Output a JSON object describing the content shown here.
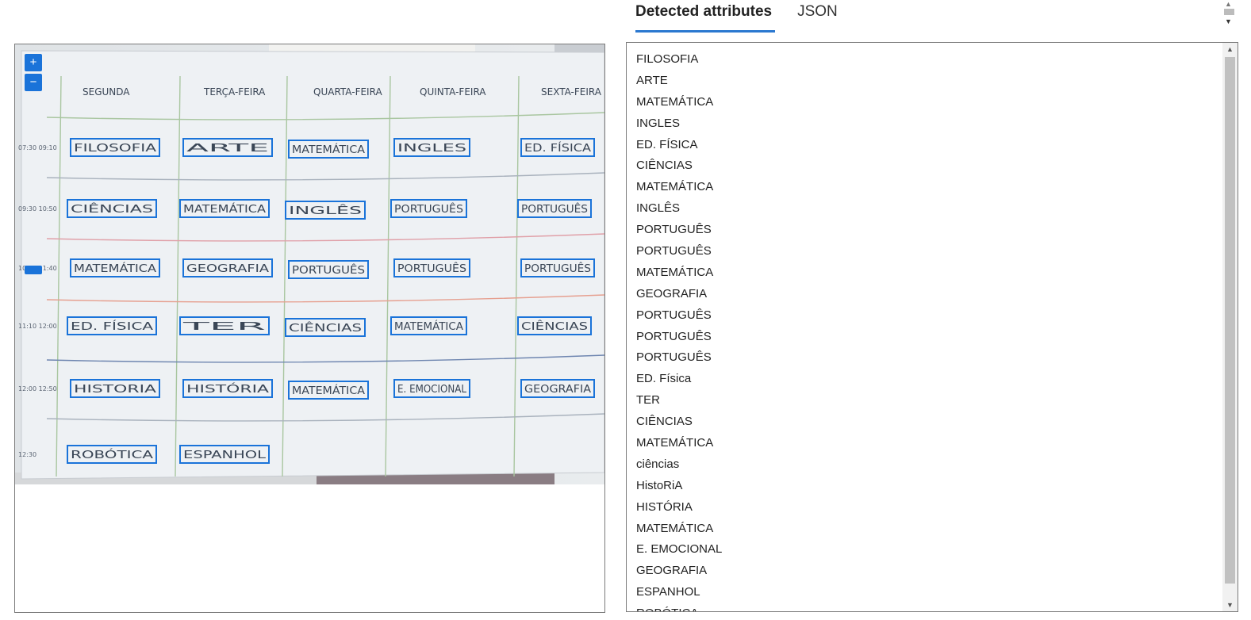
{
  "tabs": [
    {
      "label": "Detected attributes",
      "active": true
    },
    {
      "label": "JSON",
      "active": false
    }
  ],
  "viewer": {
    "zoom_in_label": "+",
    "zoom_out_label": "−",
    "board": {
      "days": [
        "SEGUNDA",
        "TERÇA-FEIRA",
        "QUARTA-FEIRA",
        "QUINTA-FEIRA",
        "SEXTA-FEIRA"
      ],
      "times": [
        "07:30 09:10",
        "09:30 10:50",
        "10:50 11:40",
        "11:10 12:00",
        "12:00 12:50",
        "12:30"
      ],
      "rows": [
        [
          "FILOSOFIA",
          "ARTE",
          "MATEMÁTICA",
          "INGLES",
          "ED. FÍSICA"
        ],
        [
          "CIÊNCIAS",
          "MATEMÁTICA",
          "INGLÊS",
          "PORTUGUÊS",
          "PORTUGUÊS"
        ],
        [
          "MATEMÁTICA",
          "GEOGRAFIA",
          "PORTUGUÊS",
          "PORTUGUÊS",
          "PORTUGUÊS"
        ],
        [
          "ED. FÍSICA",
          "TER",
          "CIÊNCIAS",
          "MATEMÁTICA",
          "CIÊNCIAS"
        ],
        [
          "HISTORIA",
          "HISTÓRIA",
          "MATEMÁTICA",
          "E. EMOCIONAL",
          "GEOGRAFIA"
        ],
        [
          "ROBÓTICA",
          "ESPANHOL",
          "",
          "",
          ""
        ]
      ]
    }
  },
  "attributes": [
    "FILOSOFIA",
    "ARTE",
    "MATEMÁTICA",
    "INGLES",
    "ED. FÍSICA",
    "CIÊNCIAS",
    "MATEMÁTICA",
    "INGLÊS",
    "PORTUGUÊS",
    "PORTUGUÊS",
    "MATEMÁTICA",
    "GEOGRAFIA",
    "PORTUGUÊS",
    "PORTUGUÊS",
    "PORTUGUÊS",
    "ED. Física",
    "TER",
    "CIÊNCIAS",
    "MATEMÁTICA",
    "ciências",
    "HistoRiA",
    "HISTÓRIA",
    "MATEMÁTICA",
    "E. EMOCIONAL",
    "GEOGRAFIA",
    "ESPANHOL",
    "ROBÓTICA"
  ],
  "colors": {
    "accent": "#1a73d9",
    "tab_underline": "#2b78d0"
  }
}
